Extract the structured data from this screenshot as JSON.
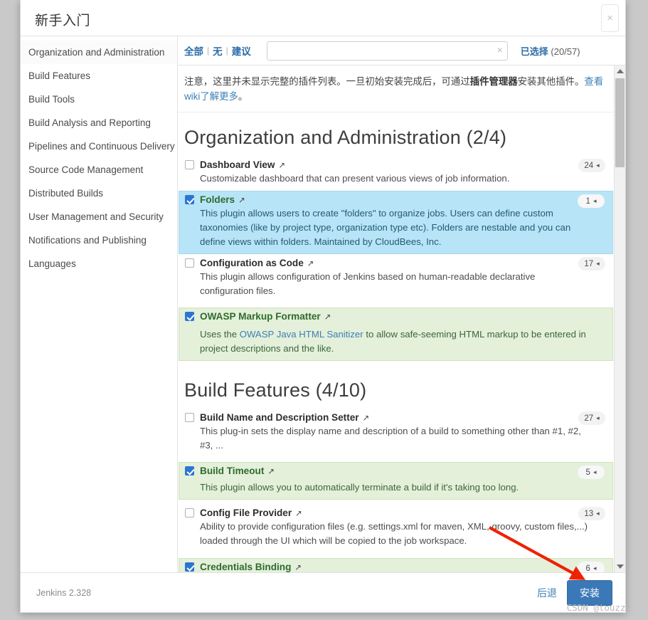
{
  "dialog": {
    "title": "新手入门",
    "close_icon": "close-icon",
    "version": "Jenkins 2.328",
    "back_label": "后退",
    "install_label": "安装"
  },
  "sidebar": {
    "items": [
      {
        "label": "Organization and Administration",
        "active": true
      },
      {
        "label": "Build Features",
        "active": false
      },
      {
        "label": "Build Tools",
        "active": false
      },
      {
        "label": "Build Analysis and Reporting",
        "active": false
      },
      {
        "label": "Pipelines and Continuous Delivery",
        "active": false
      },
      {
        "label": "Source Code Management",
        "active": false
      },
      {
        "label": "Distributed Builds",
        "active": false
      },
      {
        "label": "User Management and Security",
        "active": false
      },
      {
        "label": "Notifications and Publishing",
        "active": false
      },
      {
        "label": "Languages",
        "active": false
      }
    ]
  },
  "filterbar": {
    "all_label": "全部",
    "none_label": "无",
    "suggested_label": "建议",
    "separator": "|",
    "search_value": "",
    "search_placeholder": "",
    "clear_icon": "×",
    "selected_label": "已选择",
    "selected_count": "(20/57)"
  },
  "notice": {
    "part1": "注意，这里并未显示完整的插件列表。一旦初始安装完成后，可通过",
    "bold": "插件管理器",
    "part2": "安装其他插件。",
    "link1": "查看",
    "link2": "wiki",
    "link3": "了解更多",
    "tail": "。"
  },
  "sections": [
    {
      "title": "Organization and Administration (2/4)",
      "plugins": [
        {
          "name": "Dashboard View",
          "checked": false,
          "state": "normal",
          "count": "24",
          "desc": "Customizable dashboard that can present various views of job information.",
          "ext_icon": "↗"
        },
        {
          "name": "Folders",
          "checked": true,
          "state": "hover",
          "count": "1",
          "desc": "This plugin allows users to create \"folders\" to organize jobs. Users can define custom taxonomies (like by project type, organization type etc). Folders are nestable and you can define views within folders. Maintained by CloudBees, Inc.",
          "ext_icon": "↗"
        },
        {
          "name": "Configuration as Code",
          "checked": false,
          "state": "normal",
          "count": "17",
          "desc": "This plugin allows configuration of Jenkins based on human-readable declarative configuration files.",
          "ext_icon": "↗"
        },
        {
          "name": "OWASP Markup Formatter",
          "checked": true,
          "state": "selected",
          "count": "",
          "desc_pre": "Uses the ",
          "desc_link": "OWASP Java HTML Sanitizer",
          "desc_post": " to allow safe-seeming HTML markup to be entered in project descriptions and the like.",
          "ext_icon": "↗"
        }
      ]
    },
    {
      "title": "Build Features (4/10)",
      "plugins": [
        {
          "name": "Build Name and Description Setter",
          "checked": false,
          "state": "normal",
          "count": "27",
          "desc": "This plug-in sets the display name and description of a build to something other than #1, #2, #3, ...",
          "ext_icon": "↗"
        },
        {
          "name": "Build Timeout",
          "checked": true,
          "state": "selected",
          "count": "5",
          "desc": "This plugin allows you to automatically terminate a build if it's taking too long.",
          "ext_icon": "↗"
        },
        {
          "name": "Config File Provider",
          "checked": false,
          "state": "normal",
          "count": "13",
          "desc": "Ability to provide configuration files (e.g. settings.xml for maven, XML, groovy, custom files,...) loaded through the UI which will be copied to the job workspace.",
          "ext_icon": "↗"
        },
        {
          "name": "Credentials Binding",
          "checked": true,
          "state": "selected",
          "count": "6",
          "desc": "",
          "ext_icon": "↗"
        }
      ]
    }
  ],
  "scrollbar": {
    "up_icon": "scroll-up-arrow",
    "down_icon": "scroll-down-arrow"
  },
  "annotation": {
    "arrow_color": "#ee2200",
    "watermark": "CSDN @touzzz"
  },
  "colors": {
    "accent": "#3b78b7",
    "link": "#3d7fb5",
    "selected_row_bg": "#e4f0da",
    "hover_row_bg": "#b7e4f6",
    "checkbox_on": "#2a76d2"
  }
}
